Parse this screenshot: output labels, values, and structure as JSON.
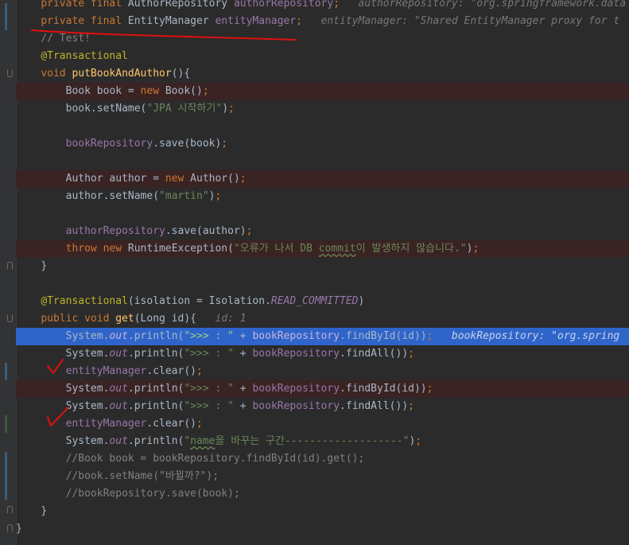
{
  "editor": {
    "lines": [
      {
        "parts": [
          {
            "t": "    "
          },
          {
            "t": "private final ",
            "c": "kw"
          },
          {
            "t": "AuthorRepository "
          },
          {
            "t": "authorRepository",
            "c": "fld"
          },
          {
            "t": ";",
            "c": "kw"
          },
          {
            "t": "   authorRepository: \"org.springframework.data",
            "c": "hint"
          }
        ]
      },
      {
        "parts": [
          {
            "t": "    "
          },
          {
            "t": "private final ",
            "c": "kw"
          },
          {
            "t": "EntityManager "
          },
          {
            "t": "entityManager",
            "c": "fld"
          },
          {
            "t": ";",
            "c": "kw"
          },
          {
            "t": "   entityManager: \"Shared EntityManager proxy for t",
            "c": "hint"
          }
        ]
      },
      {
        "parts": [
          {
            "t": "    "
          },
          {
            "t": "// Test!",
            "c": "cmt"
          }
        ]
      },
      {
        "parts": [
          {
            "t": "    "
          },
          {
            "t": "@Transactional",
            "c": "ann"
          }
        ]
      },
      {
        "parts": [
          {
            "t": "    "
          },
          {
            "t": "void ",
            "c": "kw"
          },
          {
            "t": "putBookAndAuthor",
            "c": "mth"
          },
          {
            "t": "(){"
          }
        ]
      },
      {
        "bg": "bp",
        "parts": [
          {
            "t": "        "
          },
          {
            "t": "Book book = "
          },
          {
            "t": "new ",
            "c": "kw"
          },
          {
            "t": "Book()"
          },
          {
            "t": ";",
            "c": "kw"
          }
        ]
      },
      {
        "parts": [
          {
            "t": "        "
          },
          {
            "t": "book.setName("
          },
          {
            "t": "\"JPA 시작하기\"",
            "c": "str"
          },
          {
            "t": ")"
          },
          {
            "t": ";",
            "c": "kw"
          }
        ]
      },
      {
        "parts": []
      },
      {
        "parts": [
          {
            "t": "        "
          },
          {
            "t": "bookRepository",
            "c": "fld"
          },
          {
            "t": ".save(book)"
          },
          {
            "t": ";",
            "c": "kw"
          }
        ]
      },
      {
        "parts": []
      },
      {
        "bg": "bp",
        "parts": [
          {
            "t": "        "
          },
          {
            "t": "Author author = "
          },
          {
            "t": "new ",
            "c": "kw"
          },
          {
            "t": "Author()"
          },
          {
            "t": ";",
            "c": "kw"
          }
        ]
      },
      {
        "parts": [
          {
            "t": "        "
          },
          {
            "t": "author.setName("
          },
          {
            "t": "\"martin\"",
            "c": "str"
          },
          {
            "t": ")"
          },
          {
            "t": ";",
            "c": "kw"
          }
        ]
      },
      {
        "parts": []
      },
      {
        "parts": [
          {
            "t": "        "
          },
          {
            "t": "authorRepository",
            "c": "fld"
          },
          {
            "t": ".save(author)"
          },
          {
            "t": ";",
            "c": "kw"
          }
        ]
      },
      {
        "bg": "bp",
        "parts": [
          {
            "t": "        "
          },
          {
            "t": "throw new ",
            "c": "kw"
          },
          {
            "t": "RuntimeException("
          },
          {
            "t": "\"오류가 나서 DB ",
            "c": "str"
          },
          {
            "t": "commit",
            "c": "str ul"
          },
          {
            "t": "이 발생하지 않습니다.\"",
            "c": "str"
          },
          {
            "t": ")"
          },
          {
            "t": ";",
            "c": "kw"
          }
        ]
      },
      {
        "parts": [
          {
            "t": "    "
          },
          {
            "t": "}"
          }
        ]
      },
      {
        "parts": []
      },
      {
        "parts": [
          {
            "t": "    "
          },
          {
            "t": "@Transactional",
            "c": "ann"
          },
          {
            "t": "(isolation = Isolation."
          },
          {
            "t": "READ_COMMITTED",
            "c": "fld it"
          },
          {
            "t": ")"
          }
        ]
      },
      {
        "parts": [
          {
            "t": "    "
          },
          {
            "t": "public void ",
            "c": "kw"
          },
          {
            "t": "get",
            "c": "mth"
          },
          {
            "t": "(Long id){"
          },
          {
            "t": "   id: ",
            "c": "hint"
          },
          {
            "t": "1",
            "c": "hint"
          }
        ]
      },
      {
        "bg": "cur",
        "parts": [
          {
            "t": "        "
          },
          {
            "t": "System."
          },
          {
            "t": "out",
            "c": "fld it"
          },
          {
            "t": ".println("
          },
          {
            "t": "\">>> : \"",
            "c": "str"
          },
          {
            "t": " + "
          },
          {
            "t": "bookRepository",
            "c": "fld"
          },
          {
            "t": ".findById(id))"
          },
          {
            "t": ";",
            "c": "kw"
          },
          {
            "t": "   bookRepository: \"org.spring",
            "c": "hint"
          }
        ]
      },
      {
        "parts": [
          {
            "t": "        "
          },
          {
            "t": "System."
          },
          {
            "t": "out",
            "c": "fld it"
          },
          {
            "t": ".println("
          },
          {
            "t": "\">>> : \"",
            "c": "str"
          },
          {
            "t": " + "
          },
          {
            "t": "bookRepository",
            "c": "fld"
          },
          {
            "t": ".findAll())"
          },
          {
            "t": ";",
            "c": "kw"
          }
        ]
      },
      {
        "parts": [
          {
            "t": "        "
          },
          {
            "t": "entityManager",
            "c": "fld"
          },
          {
            "t": ".clear()"
          },
          {
            "t": ";",
            "c": "kw"
          }
        ]
      },
      {
        "bg": "bp",
        "parts": [
          {
            "t": "        "
          },
          {
            "t": "System."
          },
          {
            "t": "out",
            "c": "fld it"
          },
          {
            "t": ".println("
          },
          {
            "t": "\">>> : \"",
            "c": "str"
          },
          {
            "t": " + "
          },
          {
            "t": "bookRepository",
            "c": "fld"
          },
          {
            "t": ".findById(id))"
          },
          {
            "t": ";",
            "c": "kw"
          }
        ]
      },
      {
        "parts": [
          {
            "t": "        "
          },
          {
            "t": "System."
          },
          {
            "t": "out",
            "c": "fld it"
          },
          {
            "t": ".println("
          },
          {
            "t": "\">>> : \"",
            "c": "str"
          },
          {
            "t": " + "
          },
          {
            "t": "bookRepository",
            "c": "fld"
          },
          {
            "t": ".findAll())"
          },
          {
            "t": ";",
            "c": "kw"
          }
        ]
      },
      {
        "parts": [
          {
            "t": "        "
          },
          {
            "t": "entityManager",
            "c": "fld"
          },
          {
            "t": ".clear()"
          },
          {
            "t": ";",
            "c": "kw"
          }
        ]
      },
      {
        "parts": [
          {
            "t": "        "
          },
          {
            "t": "System."
          },
          {
            "t": "out",
            "c": "fld it"
          },
          {
            "t": ".println("
          },
          {
            "t": "\"",
            "c": "str"
          },
          {
            "t": "name",
            "c": "str ul"
          },
          {
            "t": "을 바꾸는 구간-------------------\"",
            "c": "str"
          },
          {
            "t": ")"
          },
          {
            "t": ";",
            "c": "kw"
          }
        ]
      },
      {
        "parts": [
          {
            "t": "        "
          },
          {
            "t": "//Book book = bookRepository.findById(id).get();",
            "c": "cmt"
          }
        ]
      },
      {
        "parts": [
          {
            "t": "        "
          },
          {
            "t": "//book.setName(\"바뀔까?\");",
            "c": "cmt"
          }
        ]
      },
      {
        "parts": [
          {
            "t": "        "
          },
          {
            "t": "//bookRepository.save(book);",
            "c": "cmt"
          }
        ]
      },
      {
        "parts": [
          {
            "t": "    "
          },
          {
            "t": "}"
          }
        ]
      },
      {
        "parts": [
          {
            "t": "}"
          }
        ]
      }
    ]
  },
  "colors": {
    "background": "#2b2b2b",
    "gutter": "#313335",
    "breakpoint_line": "#3a2323",
    "current_line": "#2f65ca",
    "annotation_ink": "#e01010"
  },
  "annotations": [
    "red-underline",
    "red-checkmark",
    "red-checkmark"
  ]
}
